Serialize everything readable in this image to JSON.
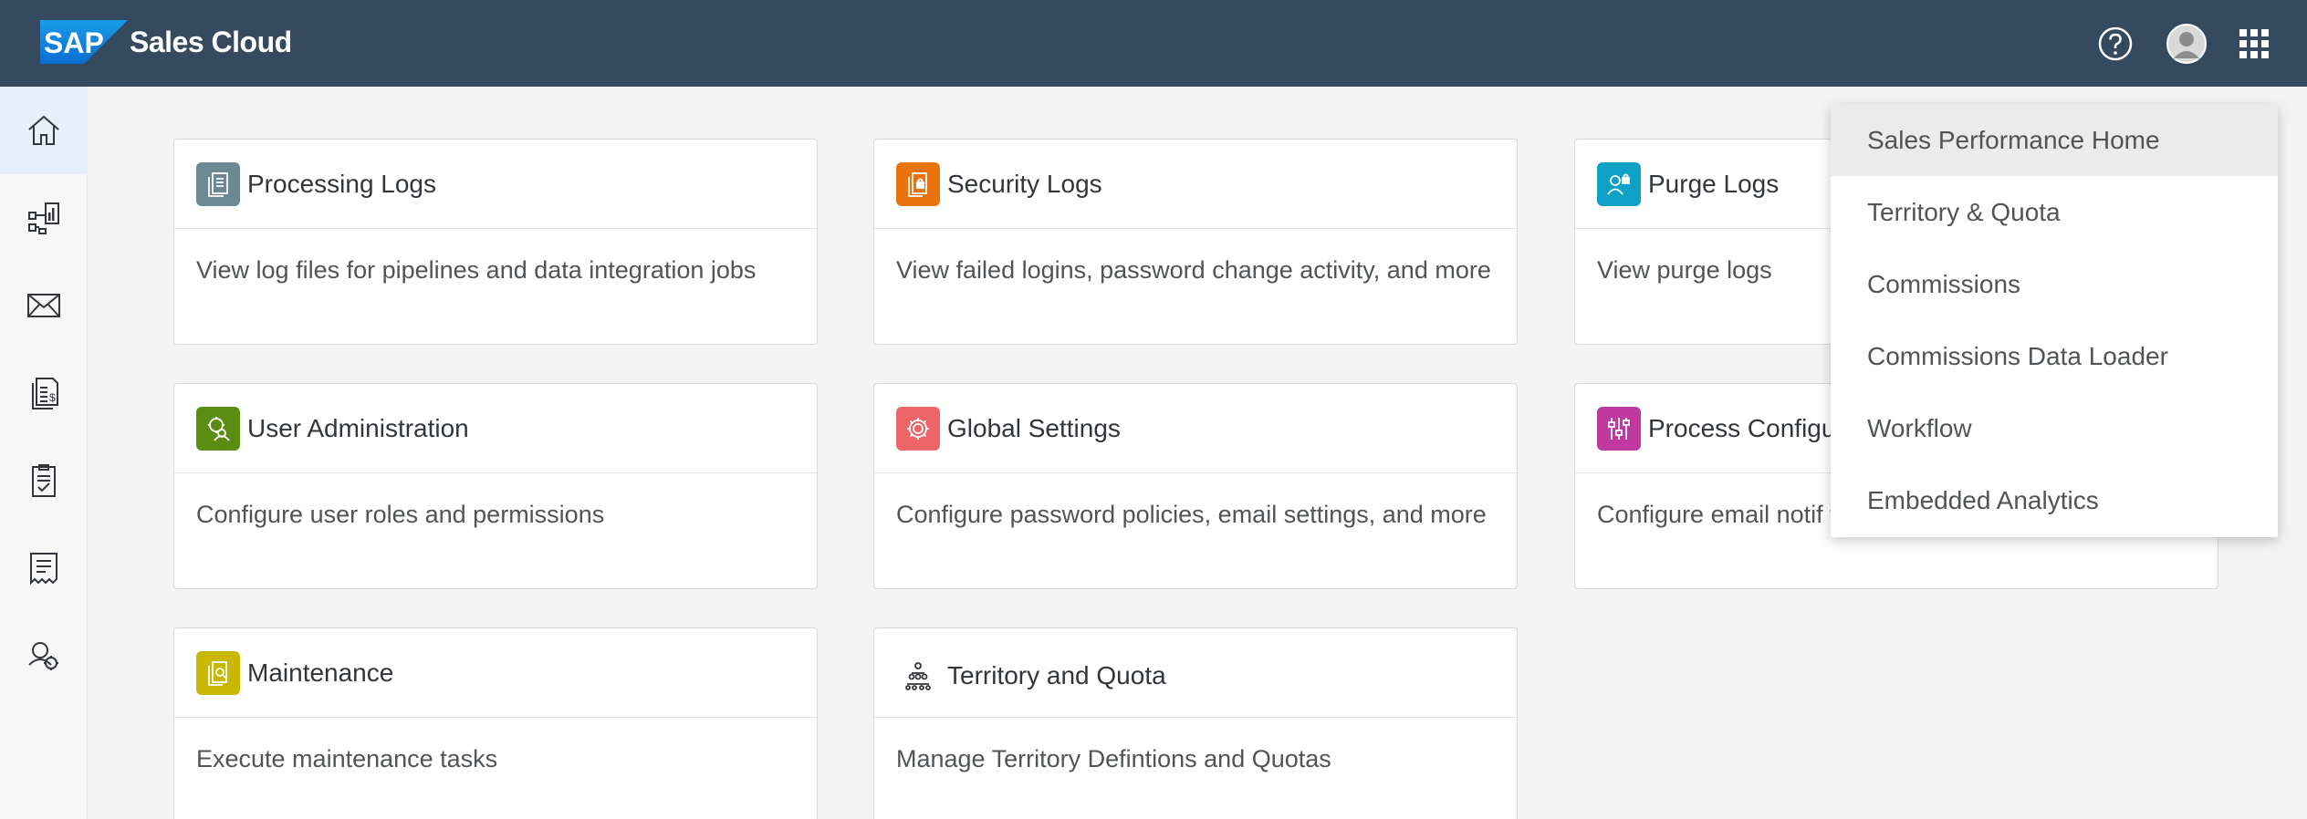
{
  "header": {
    "logo_text": "SAP",
    "product_name": "Sales Cloud",
    "icons": [
      "help-icon",
      "user-avatar",
      "app-launcher-icon"
    ]
  },
  "sidenav": {
    "items": [
      {
        "icon": "home-icon",
        "active": true
      },
      {
        "icon": "dashboard-chart-icon"
      },
      {
        "icon": "mail-icon"
      },
      {
        "icon": "commissions-document-icon"
      },
      {
        "icon": "checklist-icon"
      },
      {
        "icon": "receipt-icon"
      },
      {
        "icon": "user-settings-icon"
      }
    ]
  },
  "tiles": [
    {
      "title": "Processing Logs",
      "description": "View log files for pipelines and data integration jobs",
      "icon": "processing-logs-icon",
      "color": "#6c8893"
    },
    {
      "title": "Security Logs",
      "description": "View failed logins, password change activity, and more",
      "icon": "security-logs-icon",
      "color": "#e9730c"
    },
    {
      "title": "Purge Logs",
      "description": "View purge logs",
      "icon": "purge-logs-icon",
      "color": "#0fa0c6"
    },
    {
      "title": "User Administration",
      "description": "Configure user roles and permissions",
      "icon": "user-admin-icon",
      "color": "#5b8d15"
    },
    {
      "title": "Global Settings",
      "description": "Configure password policies, email settings, and more",
      "icon": "global-settings-icon",
      "color": "#ed6469"
    },
    {
      "title": "Process Configu",
      "description": "Configure email notif templates",
      "icon": "process-config-icon",
      "color": "#c0399f"
    },
    {
      "title": "Maintenance",
      "description": "Execute maintenance tasks",
      "icon": "maintenance-icon",
      "color": "#c8b804"
    },
    {
      "title": "Territory and Quota",
      "description": "Manage Territory Defintions and Quotas",
      "icon": "territory-hierarchy-icon",
      "color": "#ffffff"
    }
  ],
  "app_menu": {
    "items": [
      {
        "label": "Sales Performance Home",
        "selected": true
      },
      {
        "label": "Territory & Quota"
      },
      {
        "label": "Commissions"
      },
      {
        "label": "Commissions Data Loader"
      },
      {
        "label": "Workflow"
      },
      {
        "label": "Embedded Analytics"
      }
    ]
  },
  "colors": {
    "header_bg": "#354a5f",
    "accent": "#0a6ed1",
    "sap_blue": "#0a7bd1"
  }
}
